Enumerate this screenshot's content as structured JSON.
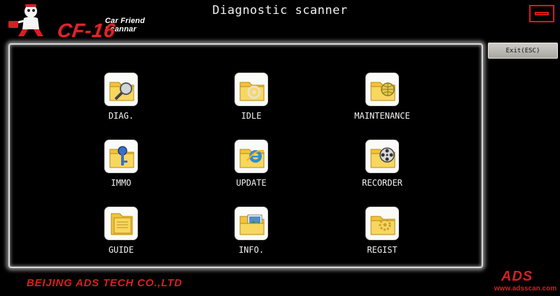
{
  "header": {
    "tagline": "Car Friend Scannar",
    "model": "CF-16",
    "title": "Diagnostic scanner"
  },
  "toolbar": {
    "exit_label": "Exit(ESC)"
  },
  "menu": {
    "items": [
      {
        "label": "DIAG.",
        "icon": "folder-magnifier-icon"
      },
      {
        "label": "IDLE",
        "icon": "folder-gear-icon"
      },
      {
        "label": "MAINTENANCE",
        "icon": "folder-globe-icon"
      },
      {
        "label": "IMMO",
        "icon": "folder-key-icon"
      },
      {
        "label": "UPDATE",
        "icon": "folder-ie-icon"
      },
      {
        "label": "RECORDER",
        "icon": "folder-film-reel-icon"
      },
      {
        "label": "GUIDE",
        "icon": "folder-book-icon"
      },
      {
        "label": "INFO.",
        "icon": "folder-picture-icon"
      },
      {
        "label": "REGIST",
        "icon": "folder-gear-registration-icon"
      }
    ]
  },
  "footer": {
    "company": "BEIJING ADS TECH CO.,LTD",
    "brand": "ADS",
    "website": "www.adsscan.com"
  },
  "colors": {
    "background": "#000000",
    "accent_red": "#d62020",
    "folder_yellow": "#f2c43a",
    "panel_border": "#d9d9d9"
  }
}
